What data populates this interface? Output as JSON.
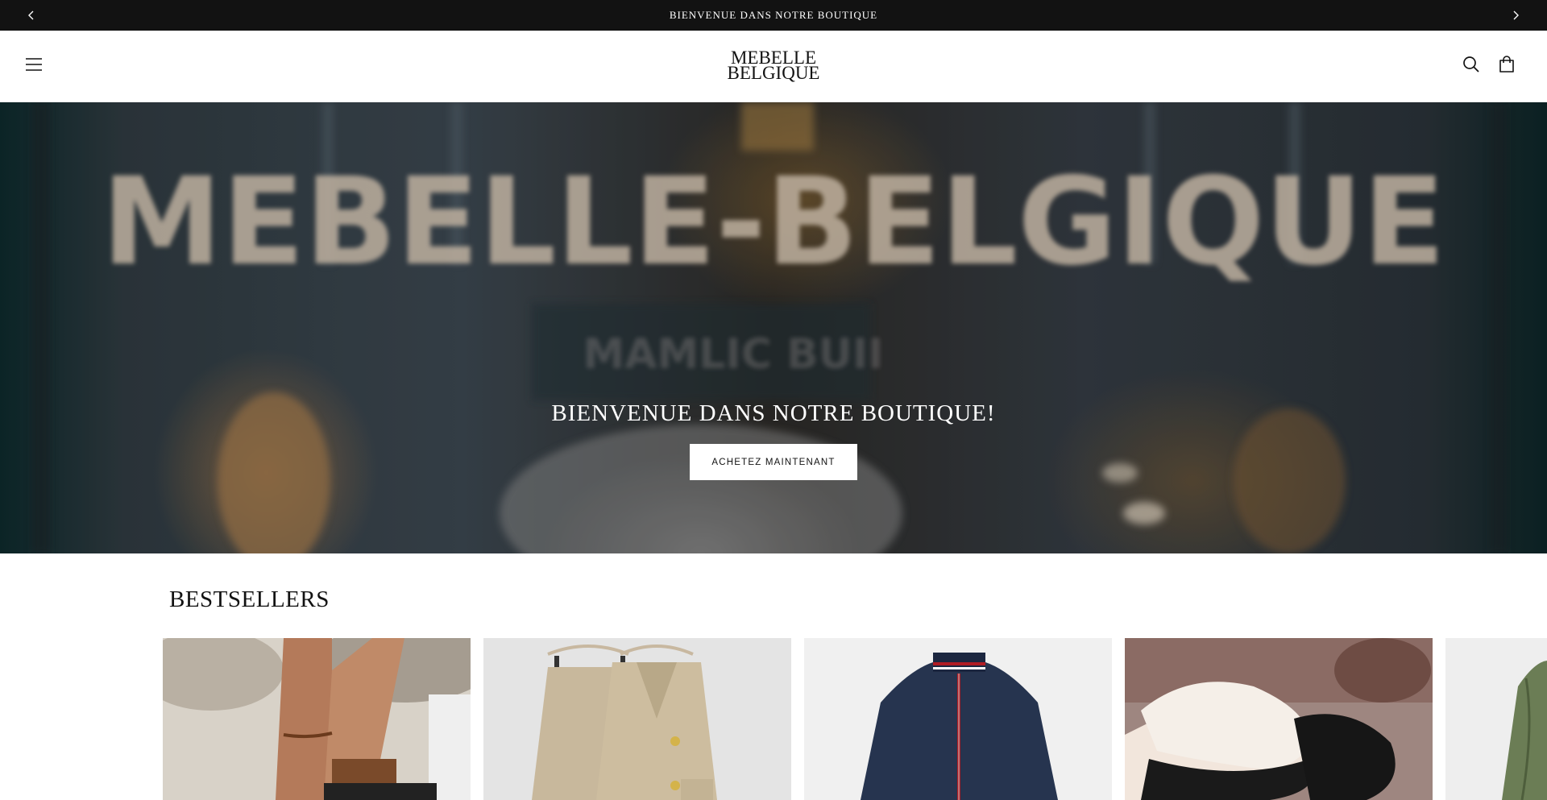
{
  "announcement": {
    "text": "BIENVENUE DANS NOTRE BOUTIQUE",
    "prev_icon": "chevron-left-icon",
    "next_icon": "chevron-right-icon"
  },
  "header": {
    "logo_line1": "MEBELLE",
    "logo_line2": "BELGIQUE",
    "menu_icon": "hamburger-menu-icon",
    "search_icon": "search-icon",
    "cart_icon": "cart-icon"
  },
  "hero": {
    "sign_text": "MEBELLE-BELGIQUE",
    "sign_subtext": "MAMLIC BUII",
    "title": "BIENVENUE DANS NOTRE BOUTIQUE!",
    "cta_label": "ACHETEZ MAINTENANT"
  },
  "bestsellers": {
    "title": "BESTSELLERS",
    "products": [
      {
        "image": "sandals-photo"
      },
      {
        "image": "beige-cardigan-set-photo"
      },
      {
        "image": "navy-jacket-photo"
      },
      {
        "image": "black-flats-photo"
      },
      {
        "image": "green-jacket-photo"
      }
    ]
  },
  "colors": {
    "announcement_bg": "#121212",
    "text": "#121212",
    "button_bg": "#ffffff"
  }
}
